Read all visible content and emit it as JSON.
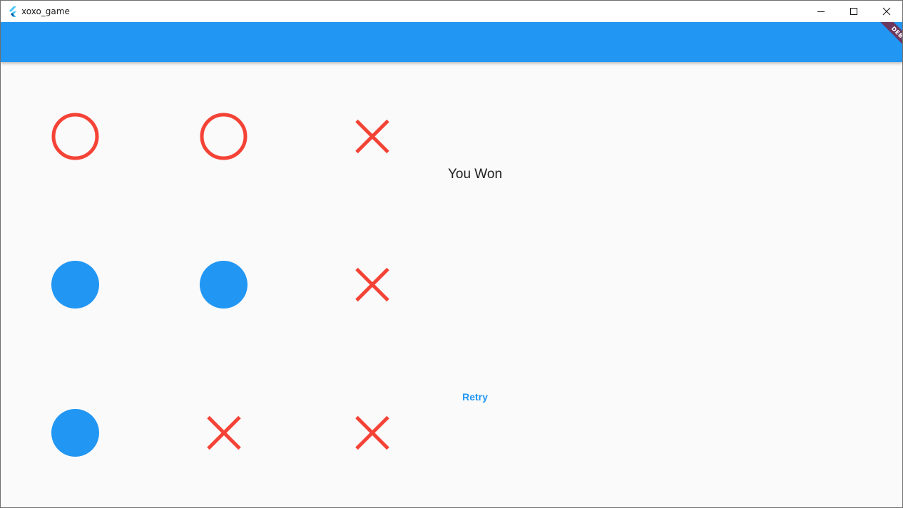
{
  "window": {
    "title": "xoxo_game",
    "icon": "flutter-logo-icon",
    "controls": [
      "minimize-icon",
      "maximize-icon",
      "close-icon"
    ]
  },
  "appbar": {
    "color": "#2196f3",
    "debug_banner": "DEBUG"
  },
  "board": {
    "cells": [
      [
        "O",
        "O",
        "X"
      ],
      [
        "filled",
        "filled",
        "X"
      ],
      [
        "filled",
        "X",
        "X"
      ]
    ],
    "colors": {
      "o_ring": "#f44336",
      "x_mark": "#f44336",
      "filled": "#2196f3"
    }
  },
  "status": {
    "message": "You Won"
  },
  "actions": {
    "retry_label": "Retry"
  }
}
